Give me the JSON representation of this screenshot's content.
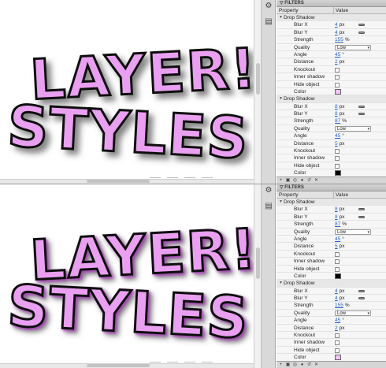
{
  "panel_title": "FILTERS",
  "columns": {
    "property": "Property",
    "value": "Value"
  },
  "artwork": {
    "line1": "LAYER!",
    "line2": "STYLES!",
    "fill": "#e9a0f0",
    "outline": "#111111",
    "shadow_top": "#7a7a7a",
    "shadow_bottom": "#a23fb0"
  },
  "top_panel": {
    "filters": [
      {
        "name": "Drop Shadow",
        "blur_x": "4",
        "blur_y": "4",
        "strength": "155",
        "quality": "Low",
        "angle": "45",
        "distance": "2",
        "color": "#f3c2f5"
      },
      {
        "name": "Drop Shadow",
        "blur_x": "8",
        "blur_y": "8",
        "strength": "87",
        "quality": "Low",
        "angle": "45",
        "distance": "5",
        "color": "#000000"
      }
    ]
  },
  "bottom_panel": {
    "filters": [
      {
        "name": "Drop Shadow",
        "blur_x": "8",
        "blur_y": "8",
        "strength": "87",
        "quality": "Low",
        "angle": "45",
        "distance": "5",
        "color": "#000000"
      },
      {
        "name": "Drop Shadow",
        "blur_x": "4",
        "blur_y": "4",
        "strength": "155",
        "quality": "Low",
        "angle": "45",
        "distance": "2",
        "color": "#f3c2f5"
      }
    ]
  },
  "labels": {
    "blur_x": "Blur X",
    "blur_y": "Blur Y",
    "strength": "Strength",
    "quality": "Quality",
    "angle": "Angle",
    "distance": "Distance",
    "knockout": "Knockout",
    "inner_shadow": "Inner shadow",
    "hide_object": "Hide object",
    "color": "Color"
  },
  "units": {
    "px": "px",
    "percent": "%",
    "degree": "°"
  }
}
